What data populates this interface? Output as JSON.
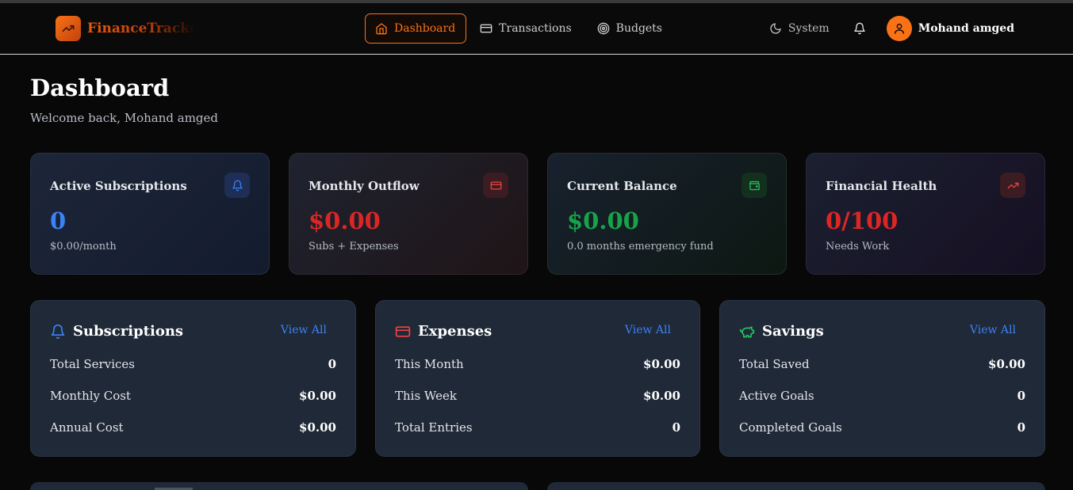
{
  "nav": {
    "brand": "FinanceTracker",
    "links": [
      {
        "label": "Dashboard",
        "icon": "home-icon",
        "active": true
      },
      {
        "label": "Transactions",
        "icon": "credit-card-icon",
        "active": false
      },
      {
        "label": "Budgets",
        "icon": "target-icon",
        "active": false
      }
    ],
    "theme_label": "System",
    "user_name": "Mohand amged"
  },
  "header": {
    "title": "Dashboard",
    "welcome": "Welcome back, Mohand amged"
  },
  "stats": [
    {
      "label": "Active Subscriptions",
      "value": "0",
      "sub": "$0.00/month",
      "icon": "bell-icon",
      "color": "#3b82f6"
    },
    {
      "label": "Monthly Outflow",
      "value": "$0.00",
      "sub": "Subs + Expenses",
      "icon": "credit-card-icon",
      "color": "#ef4444"
    },
    {
      "label": "Current Balance",
      "value": "$0.00",
      "sub": "0.0 months emergency fund",
      "icon": "wallet-icon",
      "color": "#22c55e"
    },
    {
      "label": "Financial Health",
      "value": "0/100",
      "sub": "Needs Work",
      "icon": "trending-up-icon",
      "color": "#ef4444"
    }
  ],
  "panels": [
    {
      "title": "Subscriptions",
      "icon": "bell-icon",
      "view_all": "View All",
      "rows": [
        {
          "label": "Total Services",
          "value": "0"
        },
        {
          "label": "Monthly Cost",
          "value": "$0.00"
        },
        {
          "label": "Annual Cost",
          "value": "$0.00"
        }
      ]
    },
    {
      "title": "Expenses",
      "icon": "credit-card-icon",
      "view_all": "View All",
      "rows": [
        {
          "label": "This Month",
          "value": "$0.00"
        },
        {
          "label": "This Week",
          "value": "$0.00"
        },
        {
          "label": "Total Entries",
          "value": "0"
        }
      ]
    },
    {
      "title": "Savings",
      "icon": "piggy-bank-icon",
      "view_all": "View All",
      "rows": [
        {
          "label": "Total Saved",
          "value": "$0.00"
        },
        {
          "label": "Active Goals",
          "value": "0"
        },
        {
          "label": "Completed Goals",
          "value": "0"
        }
      ]
    }
  ],
  "colors": {
    "accent": "#f97316",
    "blue": "#3b82f6",
    "red": "#ef4444",
    "green": "#22c55e",
    "panel_bg": "#1f2937"
  }
}
